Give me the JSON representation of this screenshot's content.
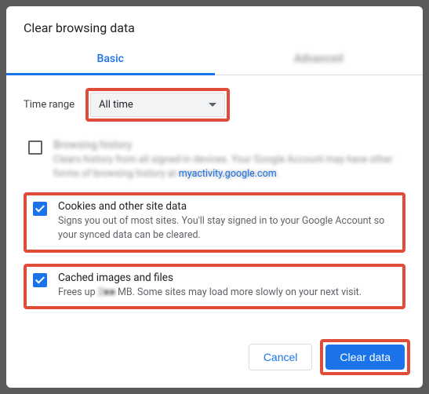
{
  "dialog": {
    "title": "Clear browsing data"
  },
  "tabs": {
    "basic": "Basic",
    "advanced": "Advanced"
  },
  "time": {
    "label": "Time range",
    "selected": "All time"
  },
  "items": {
    "history": {
      "title": "Browsing history",
      "desc_pre": "Clears history from all signed-in devices. Your Google Account may have other forms of browsing history at ",
      "link": "myactivity.google.com",
      "desc_post": ".",
      "checked": false
    },
    "cookies": {
      "title": "Cookies and other site data",
      "desc": "Signs you out of most sites. You'll stay signed in to your Google Account so your synced data can be cleared.",
      "checked": true
    },
    "cache": {
      "title": "Cached images and files",
      "desc_pre": "Frees up ",
      "size": "2■■",
      "desc_post": " MB. Some sites may load more slowly on your next visit.",
      "checked": true
    }
  },
  "actions": {
    "cancel": "Cancel",
    "clear": "Clear data"
  }
}
